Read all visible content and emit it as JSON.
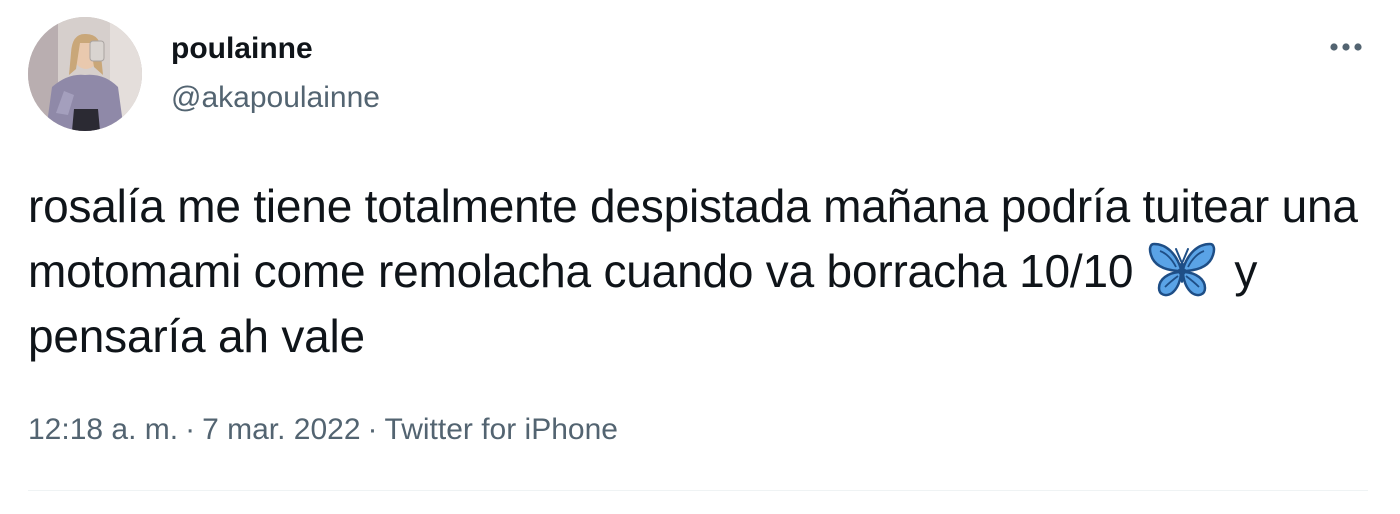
{
  "author": {
    "display_name": "poulainne",
    "handle": "@akapoulainne"
  },
  "tweet": {
    "text_part1": "rosalía me tiene totalmente despistada mañana podría tuitear una motomami come remolacha cuando va borracha 10/10",
    "emoji_icon": "butterfly-emoji",
    "text_part2": "y pensaría ah vale"
  },
  "meta": {
    "time": "12:18 a. m.",
    "date": "7 mar. 2022",
    "source": "Twitter for iPhone",
    "separator": "·"
  },
  "icons": {
    "more": "more-options-icon"
  },
  "colors": {
    "text_primary": "#0f1419",
    "text_secondary": "#536471",
    "divider": "#eff3f4",
    "butterfly": "#5aa3e6"
  }
}
